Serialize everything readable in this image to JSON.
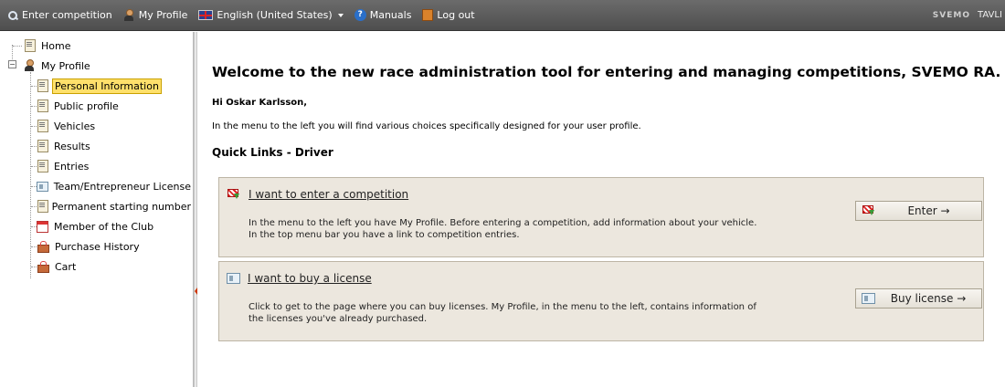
{
  "topbar": {
    "enter_competition": "Enter competition",
    "my_profile": "My Profile",
    "language": "English (United States)",
    "manuals": "Manuals",
    "log_out": "Log out",
    "brand": "SVEMO",
    "brand_right": "TÄVLI"
  },
  "sidebar": {
    "home": "Home",
    "my_profile": "My Profile",
    "items": [
      {
        "label": "Personal Information",
        "icon": "document-icon"
      },
      {
        "label": "Public profile",
        "icon": "document-icon"
      },
      {
        "label": "Vehicles",
        "icon": "document-icon"
      },
      {
        "label": "Results",
        "icon": "document-icon"
      },
      {
        "label": "Entries",
        "icon": "document-icon"
      },
      {
        "label": "Team/Entrepreneur License",
        "icon": "license-icon"
      },
      {
        "label": "Permanent starting number",
        "icon": "document-icon"
      },
      {
        "label": "Member of the Club",
        "icon": "calendar-icon"
      },
      {
        "label": "Purchase History",
        "icon": "cart-icon"
      },
      {
        "label": "Cart",
        "icon": "cart-icon"
      }
    ],
    "selected": "Personal Information"
  },
  "main": {
    "welcome": "Welcome to the new race administration tool for entering and managing competitions, SVEMO RA.",
    "greeting": "Hi Oskar Karlsson,",
    "intro": "In the menu to the left you will find various choices specifically designed for your user profile.",
    "quick_links": "Quick Links - Driver",
    "cards": [
      {
        "title": "I want to enter a competition",
        "description": "In the menu to the left you have My Profile. Before entering a competition, add information about your vehicle. In the top menu bar you have a link to competition entries.",
        "button": "Enter →"
      },
      {
        "title": "I want to buy a license",
        "description": "Click to get to the page where you can buy licenses. My Profile, in the menu to the left, contains information of the licenses you've already purchased.",
        "button": "Buy license →"
      }
    ]
  },
  "colors": {
    "topbar": "#575757",
    "selected_highlight": "#ffe06b",
    "card_background": "#ece7de"
  }
}
